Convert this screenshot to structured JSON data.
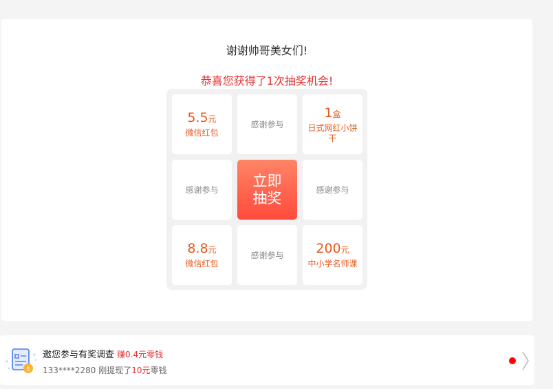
{
  "header": {
    "thanks": "谢谢帅哥美女们!",
    "congrats": "恭喜您获得了1次抽奖机会!"
  },
  "lottery": {
    "cells": [
      {
        "amount": "5.5",
        "unit": "元",
        "desc": "微信红包"
      },
      {
        "thanks": "感谢参与"
      },
      {
        "amount": "1",
        "unit": "盒",
        "desc": "日式网红小饼干"
      },
      {
        "thanks": "感谢参与"
      },
      {
        "thanks": "感谢参与"
      },
      {
        "amount": "8.8",
        "unit": "元",
        "desc": "微信红包"
      },
      {
        "thanks": "感谢参与"
      },
      {
        "amount": "200",
        "unit": "元",
        "desc": "中小学名师课"
      }
    ],
    "draw_line1": "立即",
    "draw_line2": "抽奖"
  },
  "survey": {
    "title": "邀您参与有奖调查",
    "reward": "赚0.4元零钱",
    "sub_prefix": "133****2280 刚提现了",
    "sub_amount": "10元",
    "sub_suffix": "零钱",
    "icon": "survey-form-coin-icon"
  },
  "colors": {
    "accent_red": "#e62e2e",
    "prize_orange": "#e8581c",
    "draw_button_top": "#ff8466",
    "draw_button_bottom": "#ff4a3c"
  }
}
